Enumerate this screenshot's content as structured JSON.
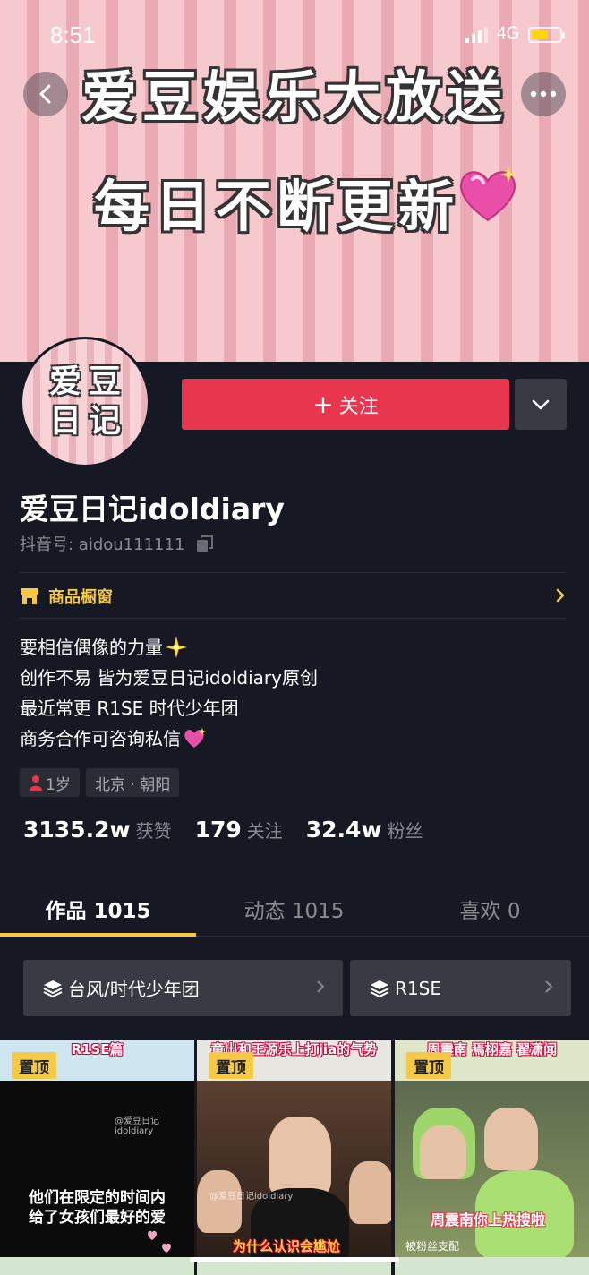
{
  "status_bar": {
    "time": "8:51",
    "network": "4G",
    "battery_color": "#ffd60a"
  },
  "banner": {
    "line1": "爱豆娱乐大放送",
    "line2": "每日不断更新"
  },
  "avatar": {
    "chars": [
      "爱",
      "豆",
      "日",
      "记"
    ]
  },
  "actions": {
    "follow_plus": "+",
    "follow_label": "关注"
  },
  "profile": {
    "username": "爱豆日记idoldiary",
    "douyin_id": "抖音号: aidou111111",
    "shop_label": "商品橱窗",
    "bio": [
      "要相信偶像的力量",
      "创作不易 皆为爱豆日记idoldiary原创",
      "最近常更 R1SE 时代少年团",
      "商务合作可咨询私信"
    ],
    "age_tag": "1岁",
    "location_tag": "北京 · 朝阳"
  },
  "stats": [
    {
      "number": "3135.2w",
      "label": "获赞"
    },
    {
      "number": "179",
      "label": "关注"
    },
    {
      "number": "32.4w",
      "label": "粉丝"
    }
  ],
  "tabs": [
    {
      "label": "作品 1015",
      "active": true
    },
    {
      "label": "动态 1015",
      "active": false
    },
    {
      "label": "喜欢 0",
      "active": false
    }
  ],
  "collections": [
    {
      "label": "台风/时代少年团"
    },
    {
      "label": "R1SE"
    }
  ],
  "videos": [
    {
      "top_text": "R1SE篇",
      "pinned": "置顶",
      "overlay": "他们在限定的时间内\n给了女孩们最好的爱",
      "watermark": "@爱豆日记idoldiary"
    },
    {
      "top_text": "童出和王源乐上打jia的气势",
      "pinned": "置顶",
      "overlay": "为什么认识会尴尬",
      "watermark": "@爱豆日记idoldiary"
    },
    {
      "top_text": "周震南 焉栩嘉 翟潇闻",
      "pinned": "置顶",
      "overlay": "周震南你上热搜啦",
      "watermark": "被粉丝支配"
    }
  ],
  "colors": {
    "accent_red": "#e8364f",
    "accent_yellow": "#f5c845",
    "background": "#161823"
  }
}
